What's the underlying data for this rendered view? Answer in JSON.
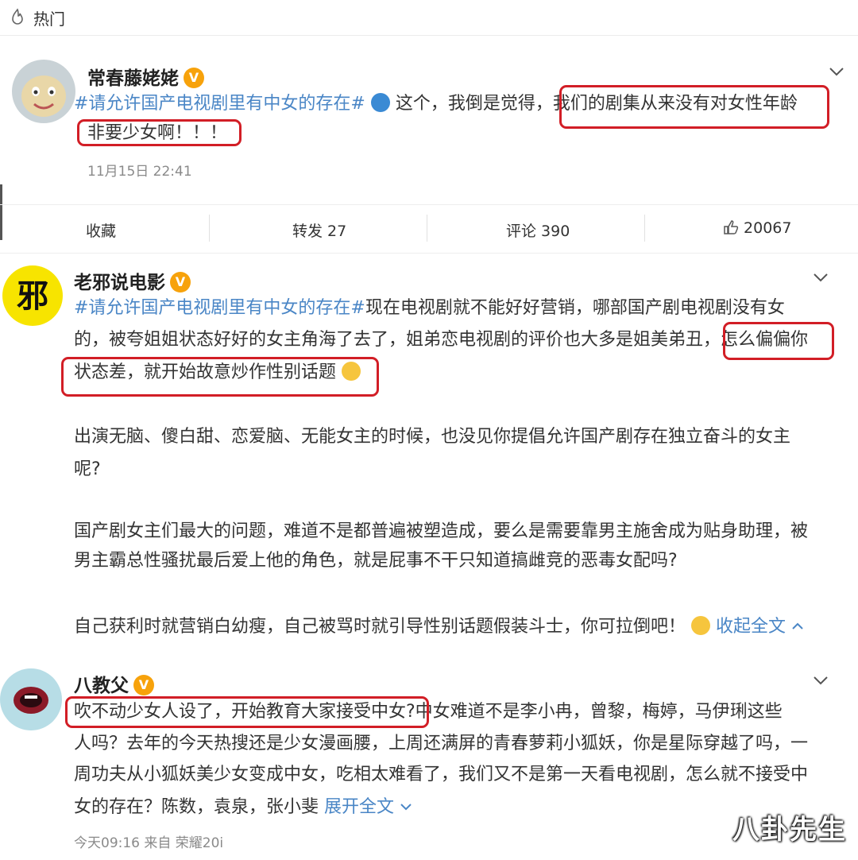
{
  "topbar": {
    "label": "热门"
  },
  "posts": [
    {
      "author": "常春藤姥姥",
      "lines": [
        "这个，我倒是觉得，我们的剧集从来没有对女性年龄",
        "非要少女啊！！！"
      ],
      "hashtag": "#请允许国产电视剧里有中女的存在#",
      "time": "11月15日 22:41"
    },
    {
      "author": "老邪说电影",
      "hashtag": "#请允许国产电视剧里有中女的存在#",
      "line1_rest": "现在电视剧就不能好好营销，哪部国产剧电视剧没有女",
      "line2": "的，被夸姐姐状态好好的女主角海了去了，姐弟恋电视剧的评价也大多是姐美弟丑，怎么偏偏你",
      "line3": "状态差，就开始故意炒作性别话题",
      "para2_line1": "出演无脑、傻白甜、恋爱脑、无能女主的时候，也没见你提倡允许国产剧存在独立奋斗的女主",
      "para2_line2": "呢?",
      "para3_line1": "国产剧女主们最大的问题，难道不是都普遍被塑造成，要么是需要靠男主施舍成为贴身助理，被",
      "para3_line2": "男主霸总性骚扰最后爱上他的角色，就是屁事不干只知道搞雌竞的恶毒女配吗?",
      "para4": "自己获利时就营销白幼瘦，自己被骂时就引导性别话题假装斗士，你可拉倒吧！",
      "collapse": "收起全文"
    },
    {
      "author": "八教父",
      "line1": "吹不动少女人设了，开始教育大家接受中女?中女难道不是李小冉，曾黎，梅婷，马伊琍这些",
      "line2": "人吗？去年的今天热搜还是少女漫画腰，上周还满屏的青春萝莉小狐妖，你是星际穿越了吗，一",
      "line3": "周功夫从小狐妖美少女变成中女，吃相太难看了，我们又不是第一天看电视剧，怎么就不接受中",
      "line4": "女的存在？陈数，袁泉，张小斐",
      "expand": "展开全文",
      "time": "今天09:16  来自 荣耀20i"
    }
  ],
  "actions": {
    "fav": "收藏",
    "repost": "转发 27",
    "comment": "评论 390",
    "like": "20067"
  },
  "watermark": "八卦先生",
  "colors": {
    "link": "#4a86c6",
    "highlight": "#d21e26",
    "badge": "#f7a20b"
  }
}
